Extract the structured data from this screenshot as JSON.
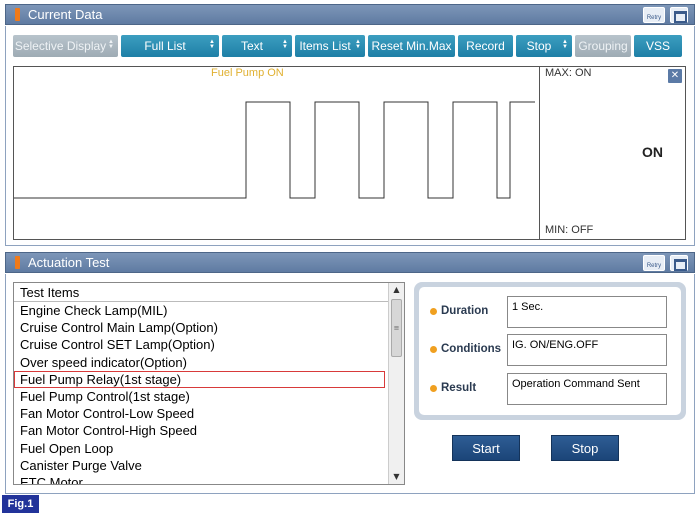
{
  "current_data": {
    "title": "Current Data",
    "retry_label": "Retry",
    "toolbar": [
      {
        "label": "Selective Display",
        "spin": true,
        "disabled": true
      },
      {
        "label": "Full List",
        "spin": true,
        "disabled": false
      },
      {
        "label": "Text",
        "spin": true,
        "disabled": false
      },
      {
        "label": "Items List",
        "spin": true,
        "disabled": false
      },
      {
        "label": "Reset Min.Max",
        "spin": false,
        "disabled": false
      },
      {
        "label": "Record",
        "spin": false,
        "disabled": false
      },
      {
        "label": "Stop",
        "spin": true,
        "disabled": false
      },
      {
        "label": "Grouping",
        "spin": false,
        "disabled": true
      },
      {
        "label": "VSS",
        "spin": false,
        "disabled": false
      }
    ],
    "graph": {
      "signal_label": "Fuel Pump ON",
      "max_label": "MAX: ON",
      "min_label": "MIN: OFF",
      "current_value": "ON",
      "line_color": "#333333"
    }
  },
  "actuation_test": {
    "title": "Actuation Test",
    "retry_label": "Retry",
    "list_header": "Test Items",
    "items": [
      "Engine Check Lamp(MIL)",
      "Cruise Control Main Lamp(Option)",
      "Cruise Control SET Lamp(Option)",
      "Over speed indicator(Option)",
      "Fuel Pump Relay(1st stage)",
      "Fuel Pump Control(1st stage)",
      "Fan Motor Control-Low Speed",
      "Fan Motor Control-High Speed",
      "Fuel Open Loop",
      "Canister Purge Valve",
      "ETC Motor"
    ],
    "selected_index": 4,
    "info": {
      "duration_label": "Duration",
      "duration_value": "1 Sec.",
      "conditions_label": "Conditions",
      "conditions_value": "IG. ON/ENG.OFF",
      "result_label": "Result",
      "result_value": "Operation Command Sent"
    },
    "start_label": "Start",
    "stop_label": "Stop"
  },
  "figure_label": "Fig.1",
  "colors": {
    "header": "#6b86ad",
    "accent_orange": "#f07a1a",
    "button_blue": "#2a8cb4",
    "selected_outline": "#d83a3a",
    "action_button": "#244f86"
  }
}
